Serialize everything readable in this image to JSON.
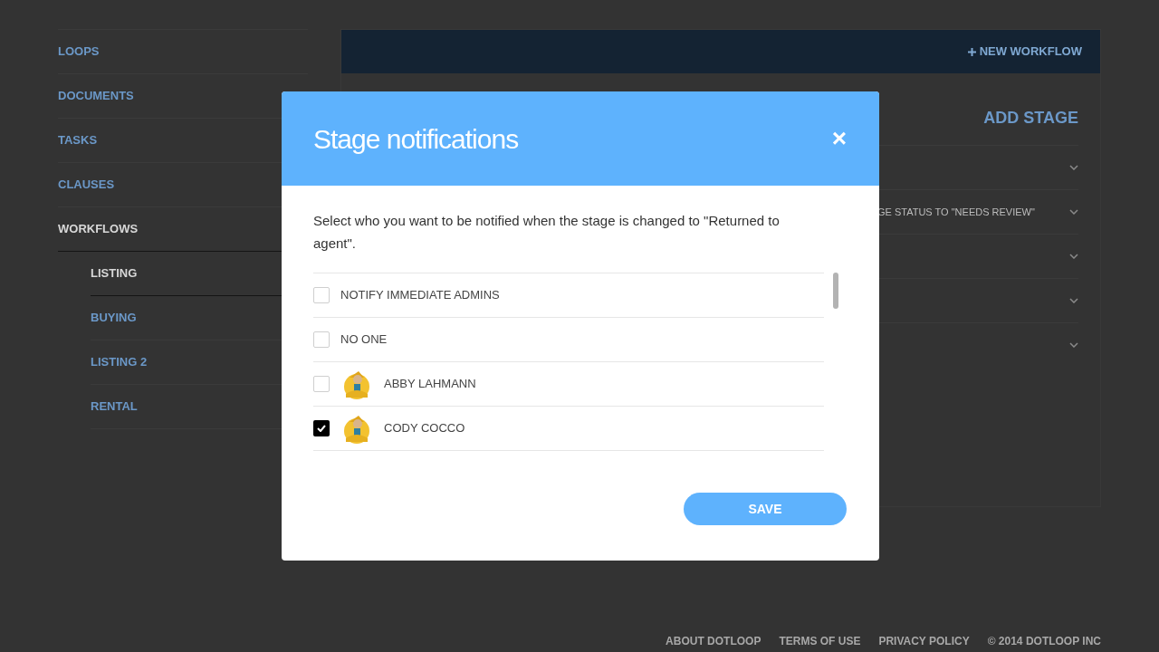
{
  "sidebar": {
    "items": [
      {
        "label": "LOOPS",
        "selected": false
      },
      {
        "label": "DOCUMENTS",
        "selected": false
      },
      {
        "label": "TASKS",
        "selected": false
      },
      {
        "label": "CLAUSES",
        "selected": false
      },
      {
        "label": "WORKFLOWS",
        "selected": true,
        "children": [
          {
            "label": "LISTING",
            "selected": true
          },
          {
            "label": "BUYING",
            "selected": false
          },
          {
            "label": "LISTING 2",
            "selected": false
          },
          {
            "label": "RENTAL",
            "selected": false
          }
        ]
      }
    ]
  },
  "main": {
    "new_workflow": "NEW WORKFLOW",
    "add_stage": "ADD STAGE",
    "rows": [
      {
        "text": ""
      },
      {
        "text": "GE STATUS TO \"NEEDS REVIEW\""
      },
      {
        "text": ""
      },
      {
        "text": ""
      },
      {
        "text": ""
      }
    ]
  },
  "modal": {
    "title": "Stage notifications",
    "close": "×",
    "description": "Select who you want to be notified when the stage is changed to \"Returned to agent\".",
    "options": [
      {
        "kind": "group",
        "label": "NOTIFY IMMEDIATE ADMINS",
        "checked": false
      },
      {
        "kind": "group",
        "label": "NO ONE",
        "checked": false
      },
      {
        "kind": "person",
        "label": "ABBY LAHMANN",
        "checked": false
      },
      {
        "kind": "person",
        "label": "CODY COCCO",
        "checked": true
      }
    ],
    "save": "SAVE"
  },
  "footer": [
    "ABOUT DOTLOOP",
    "TERMS OF USE",
    "PRIVACY POLICY",
    "© 2014 DOTLOOP INC"
  ]
}
